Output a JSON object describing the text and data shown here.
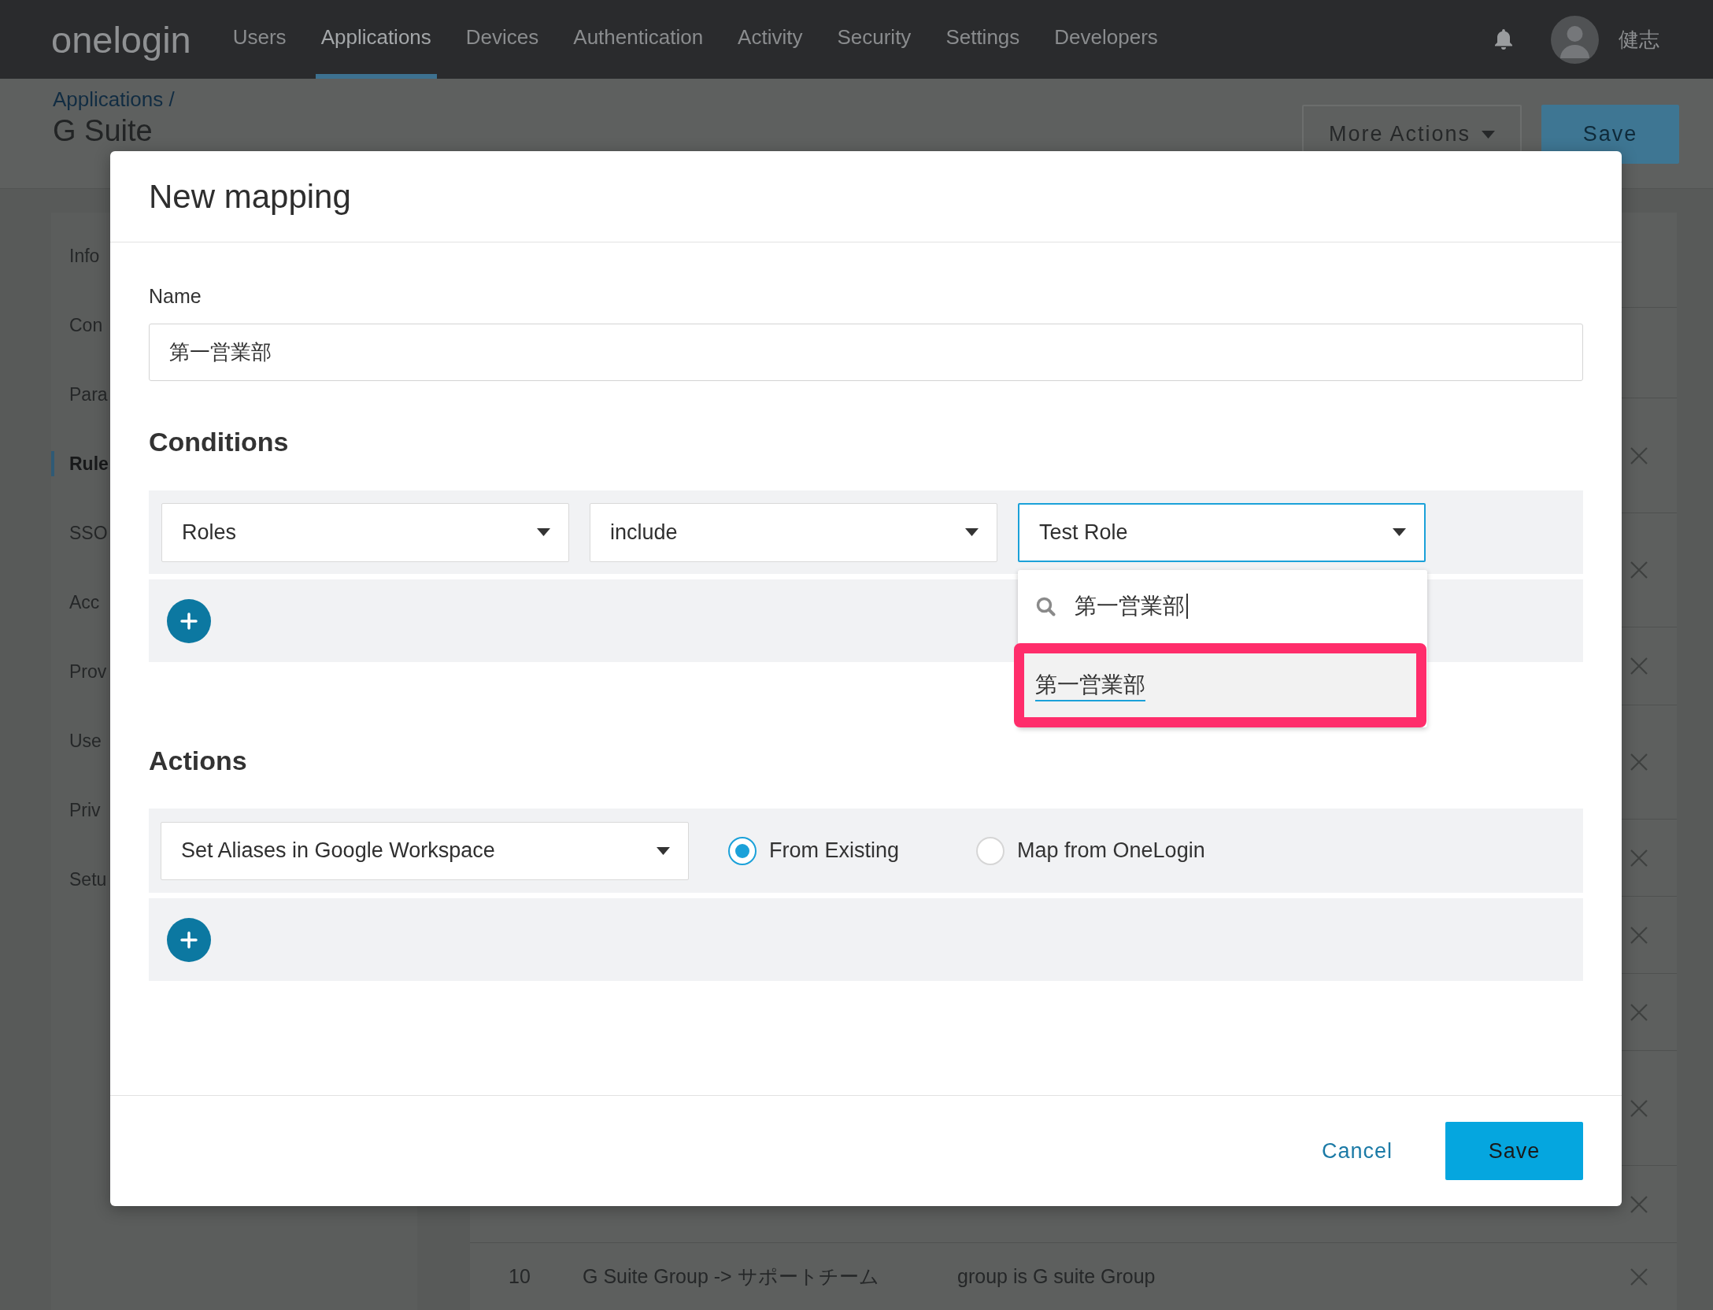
{
  "nav": {
    "logo": "onelogin",
    "items": [
      {
        "label": "Users",
        "selected": false
      },
      {
        "label": "Applications",
        "selected": true
      },
      {
        "label": "Devices",
        "selected": false
      },
      {
        "label": "Authentication",
        "selected": false
      },
      {
        "label": "Activity",
        "selected": false
      },
      {
        "label": "Security",
        "selected": false
      },
      {
        "label": "Settings",
        "selected": false
      },
      {
        "label": "Developers",
        "selected": false
      }
    ],
    "user_name": "健志"
  },
  "page": {
    "breadcrumb": "Applications /",
    "title": "G Suite",
    "buttons": [
      {
        "label": "More Actions",
        "kind": "menu"
      },
      {
        "label": "Save",
        "kind": "primary"
      }
    ]
  },
  "sidebar": {
    "items": [
      {
        "label": "Info",
        "selected": false
      },
      {
        "label": "Con",
        "selected": false
      },
      {
        "label": "Para",
        "selected": false
      },
      {
        "label": "Rule",
        "selected": true
      },
      {
        "label": "SSO",
        "selected": false
      },
      {
        "label": "Acc",
        "selected": false
      },
      {
        "label": "Prov",
        "selected": false
      },
      {
        "label": "Use",
        "selected": false
      },
      {
        "label": "Priv",
        "selected": false
      },
      {
        "label": "Setu",
        "selected": false
      }
    ]
  },
  "table": {
    "rows": [
      {
        "cells": [
          "10",
          "G Suite Group -> サポートチーム",
          "group is G suite Group"
        ]
      }
    ]
  },
  "modal": {
    "title": "New mapping",
    "name": {
      "label": "Name",
      "value": "第一営業部"
    },
    "conditions": {
      "heading": "Conditions",
      "rows": [
        {
          "fields": [
            {
              "value": "Roles",
              "open": false
            },
            {
              "value": "include",
              "open": false
            },
            {
              "value": "Test Role",
              "open": true,
              "menu": {
                "search": "第一営業部",
                "options": [
                  {
                    "label": "第一営業部",
                    "active": true,
                    "highlighted": true
                  }
                ]
              }
            }
          ]
        }
      ]
    },
    "actions": {
      "heading": "Actions",
      "rows": [
        {
          "value": "Set Aliases in Google Workspace",
          "choices": [
            {
              "label": "From Existing",
              "selected": true
            },
            {
              "label": "Map from OneLogin",
              "selected": false
            }
          ]
        }
      ]
    },
    "buttons": [
      {
        "label": "Cancel",
        "kind": "secondary"
      },
      {
        "label": "Save",
        "kind": "primary"
      }
    ]
  }
}
